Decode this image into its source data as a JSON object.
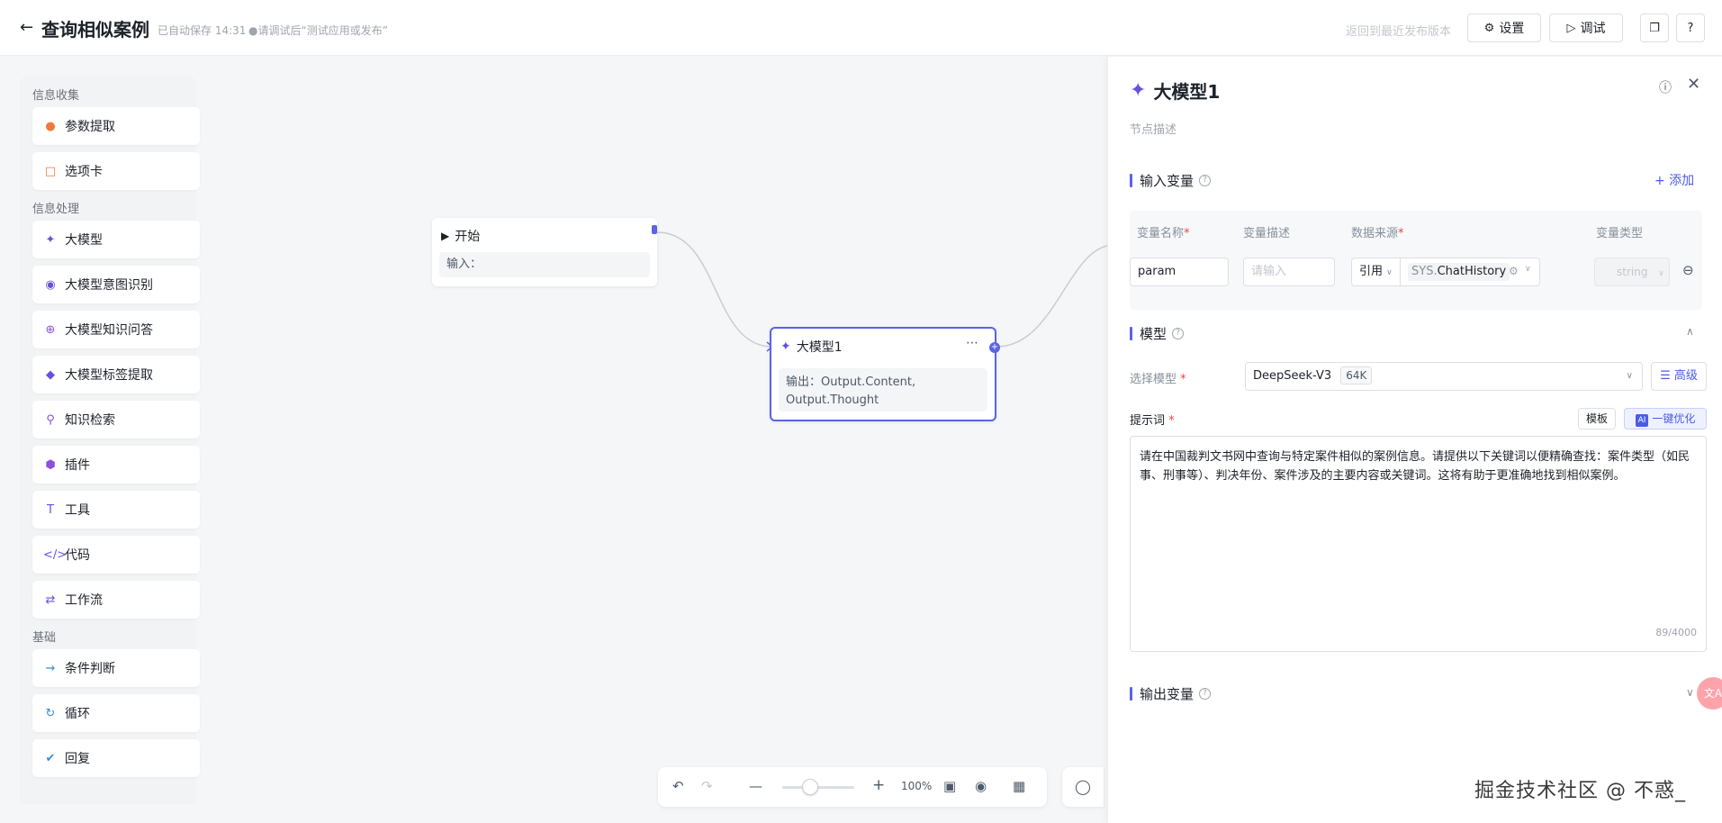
{
  "header": {
    "back_icon": "arrow-left-icon",
    "title": "查询相似案例",
    "autosave": "已自动保存 14:31",
    "hint": "●请调试后“测试应用或发布”",
    "revert": "返回到最近发布版本",
    "settings_label": "设置",
    "debug_label": "调试"
  },
  "palette": {
    "sections": [
      {
        "title": "信息收集",
        "items": [
          {
            "label": "参数提取",
            "icon": "param-extract-icon",
            "color": "#f07a3c"
          },
          {
            "label": "选项卡",
            "icon": "ab-tag-icon",
            "color": "#f07a3c"
          }
        ]
      },
      {
        "title": "信息处理",
        "items": [
          {
            "label": "大模型",
            "icon": "sparkle-icon",
            "color": "#6a4fe0"
          },
          {
            "label": "大模型意图识别",
            "icon": "robot-icon",
            "color": "#6a4fe0"
          },
          {
            "label": "大模型知识问答",
            "icon": "plus-circle-icon",
            "color": "#8e4fe0"
          },
          {
            "label": "大模型标签提取",
            "icon": "tag-icon",
            "color": "#6a4fe0"
          },
          {
            "label": "知识检索",
            "icon": "search-icon",
            "color": "#8e4fe0"
          },
          {
            "label": "插件",
            "icon": "plugin-icon",
            "color": "#8e4fe0"
          },
          {
            "label": "工具",
            "icon": "tool-icon",
            "color": "#6a4fe0"
          },
          {
            "label": "代码",
            "icon": "code-icon",
            "color": "#6a4fe0"
          },
          {
            "label": "工作流",
            "icon": "workflow-icon",
            "color": "#6a4fe0"
          }
        ]
      },
      {
        "title": "基础",
        "items": [
          {
            "label": "条件判断",
            "icon": "branch-icon",
            "color": "#2f8fe0"
          },
          {
            "label": "循环",
            "icon": "loop-icon",
            "color": "#2f8fe0"
          },
          {
            "label": "回复",
            "icon": "check-circle-icon",
            "color": "#2f8fe0"
          }
        ]
      }
    ]
  },
  "nodes": {
    "start": {
      "title": "开始",
      "body": "输入："
    },
    "llm": {
      "title": "大模型1",
      "body": "输出：Output.Content, Output.Thought"
    }
  },
  "zoom": {
    "label": "100%"
  },
  "panel": {
    "title": "大模型1",
    "desc_placeholder": "节点描述",
    "input_section": "输入变量",
    "add_label": "添加",
    "columns": {
      "name": "变量名称",
      "desc": "变量描述",
      "source": "数据来源",
      "type": "变量类型"
    },
    "row": {
      "name": "param",
      "desc_placeholder": "请输入",
      "ref_mode": "引用",
      "ref_sys": "SYS.",
      "ref_var": "ChatHistory",
      "type_placeholder": "string"
    },
    "model_section": "模型",
    "model_label": "选择模型",
    "model_value": "DeepSeek-V3",
    "model_badge": "64K",
    "advanced_label": "高级",
    "prompt_label": "提示词",
    "template_label": "模板",
    "optimize_label": "一键优化",
    "ai_tag": "AI",
    "prompt_text": "请在中国裁判文书网中查询与特定案件相似的案例信息。请提供以下关键词以便精确查找：案件类型（如民事、刑事等）、判决年份、案件涉及的主要内容或关键词。这将有助于更准确地找到相似案例。",
    "prompt_counter": "89/4000",
    "output_section": "输出变量"
  },
  "watermark": "掘金技术社区 @ 不惑_",
  "bubble_text": "文A"
}
